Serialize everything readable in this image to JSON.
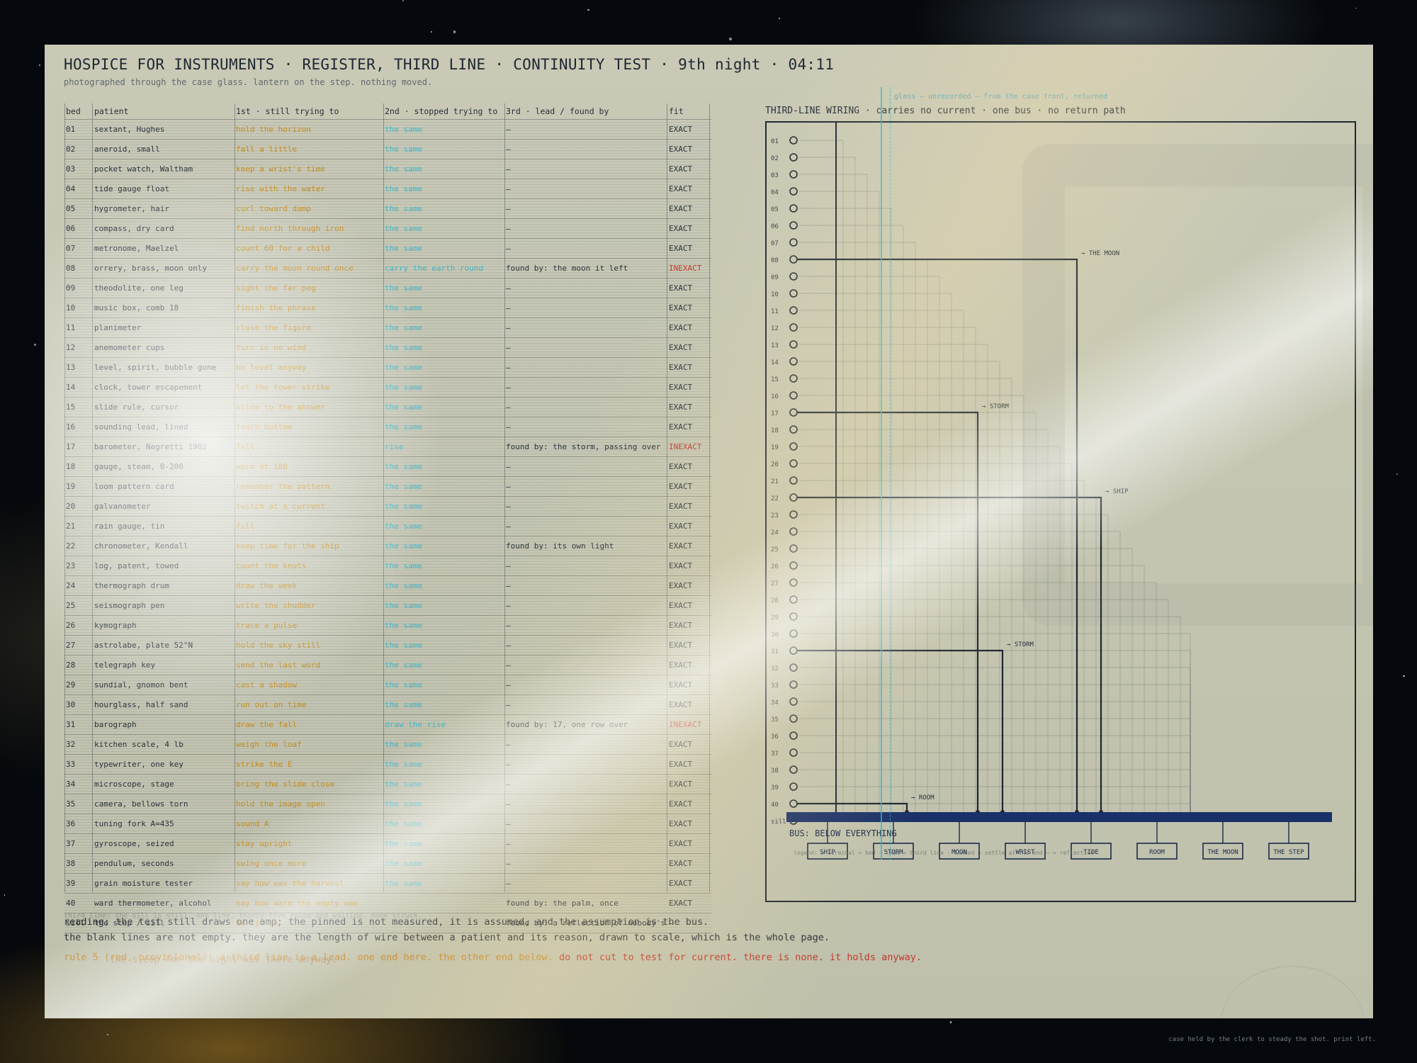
{
  "title": "HOSPICE FOR INSTRUMENTS · REGISTER, THIRD LINE · CONTINUITY TEST · 9th night · 04:11",
  "subtitle": "photographed through the case glass. lantern on the step. nothing moved.",
  "glass_label": "glass — unrecorded — from the case front, returned",
  "columns": {
    "bed": "bed",
    "patient": "patient",
    "first": "1st · still trying to",
    "second": "2nd · stopped trying to",
    "third": "3rd · lead / found by",
    "fit": "fit"
  },
  "rows": [
    {
      "bed": "01",
      "patient": "sextant, Hughes",
      "first": "hold the horizon",
      "second": "the same",
      "third": "—",
      "fit": "EXACT"
    },
    {
      "bed": "02",
      "patient": "aneroid, small",
      "first": "fall a little",
      "second": "the same",
      "third": "—",
      "fit": "EXACT"
    },
    {
      "bed": "03",
      "patient": "pocket watch, Waltham",
      "first": "keep a wrist's time",
      "second": "the same",
      "third": "—",
      "fit": "EXACT"
    },
    {
      "bed": "04",
      "patient": "tide gauge float",
      "first": "rise with the water",
      "second": "the same",
      "third": "—",
      "fit": "EXACT"
    },
    {
      "bed": "05",
      "patient": "hygrometer, hair",
      "first": "curl toward damp",
      "second": "the same",
      "third": "—",
      "fit": "EXACT"
    },
    {
      "bed": "06",
      "patient": "compass, dry card",
      "first": "find north through iron",
      "second": "the same",
      "third": "—",
      "fit": "EXACT"
    },
    {
      "bed": "07",
      "patient": "metronome, Maelzel",
      "first": "count 60 for a child",
      "second": "the same",
      "third": "—",
      "fit": "EXACT"
    },
    {
      "bed": "08",
      "patient": "orrery, brass, moon only",
      "first": "carry the moon round once",
      "second": "carry the earth round",
      "third": "found by: the moon it left",
      "fit": "INEXACT"
    },
    {
      "bed": "09",
      "patient": "theodolite, one leg",
      "first": "sight the far peg",
      "second": "the same",
      "third": "—",
      "fit": "EXACT"
    },
    {
      "bed": "10",
      "patient": "music box, comb 18",
      "first": "finish the phrase",
      "second": "the same",
      "third": "—",
      "fit": "EXACT"
    },
    {
      "bed": "11",
      "patient": "planimeter",
      "first": "close the figure",
      "second": "the same",
      "third": "—",
      "fit": "EXACT"
    },
    {
      "bed": "12",
      "patient": "anemometer cups",
      "first": "turn in no wind",
      "second": "the same",
      "third": "—",
      "fit": "EXACT"
    },
    {
      "bed": "13",
      "patient": "level, spirit, bubble gone",
      "first": "be level anyway",
      "second": "the same",
      "third": "—",
      "fit": "EXACT"
    },
    {
      "bed": "14",
      "patient": "clock, tower escapement",
      "first": "let the tower strike",
      "second": "the same",
      "third": "—",
      "fit": "EXACT"
    },
    {
      "bed": "15",
      "patient": "slide rule, cursor",
      "first": "slide to the answer",
      "second": "the same",
      "third": "—",
      "fit": "EXACT"
    },
    {
      "bed": "16",
      "patient": "sounding lead, lined",
      "first": "touch bottom",
      "second": "the same",
      "third": "—",
      "fit": "EXACT"
    },
    {
      "bed": "17",
      "patient": "barometer, Negretti 1902",
      "first": "fall",
      "second": "rise",
      "third": "found by: the storm, passing over",
      "fit": "INEXACT"
    },
    {
      "bed": "18",
      "patient": "gauge, steam, 0-200",
      "first": "warn at 180",
      "second": "the same",
      "third": "—",
      "fit": "EXACT"
    },
    {
      "bed": "19",
      "patient": "loom pattern card",
      "first": "remember the pattern",
      "second": "the same",
      "third": "—",
      "fit": "EXACT"
    },
    {
      "bed": "20",
      "patient": "galvanometer",
      "first": "twitch at a current",
      "second": "the same",
      "third": "—",
      "fit": "EXACT"
    },
    {
      "bed": "21",
      "patient": "rain gauge, tin",
      "first": "fill",
      "second": "the same",
      "third": "—",
      "fit": "EXACT"
    },
    {
      "bed": "22",
      "patient": "chronometer, Kendall",
      "first": "keep time for the ship",
      "second": "the same",
      "third": "found by: its own light",
      "fit": "EXACT"
    },
    {
      "bed": "23",
      "patient": "log, patent, towed",
      "first": "count the knots",
      "second": "the same",
      "third": "—",
      "fit": "EXACT"
    },
    {
      "bed": "24",
      "patient": "thermograph drum",
      "first": "draw the week",
      "second": "the same",
      "third": "—",
      "fit": "EXACT"
    },
    {
      "bed": "25",
      "patient": "seismograph pen",
      "first": "write the shudder",
      "second": "the same",
      "third": "—",
      "fit": "EXACT"
    },
    {
      "bed": "26",
      "patient": "kymograph",
      "first": "trace a pulse",
      "second": "the same",
      "third": "—",
      "fit": "EXACT"
    },
    {
      "bed": "27",
      "patient": "astrolabe, plate 52°N",
      "first": "hold the sky still",
      "second": "the same",
      "third": "—",
      "fit": "EXACT"
    },
    {
      "bed": "28",
      "patient": "telegraph key",
      "first": "send the last word",
      "second": "the same",
      "third": "—",
      "fit": "EXACT"
    },
    {
      "bed": "29",
      "patient": "sundial, gnomon bent",
      "first": "cast a shadow",
      "second": "the same",
      "third": "—",
      "fit": "EXACT"
    },
    {
      "bed": "30",
      "patient": "hourglass, half sand",
      "first": "run out on time",
      "second": "the same",
      "third": "—",
      "fit": "EXACT"
    },
    {
      "bed": "31",
      "patient": "barograph",
      "first": "draw the fall",
      "second": "draw the rise",
      "third": "found by: 17, one row over",
      "fit": "INEXACT"
    },
    {
      "bed": "32",
      "patient": "kitchen scale, 4 lb",
      "first": "weigh the loaf",
      "second": "the same",
      "third": "—",
      "fit": "EXACT"
    },
    {
      "bed": "33",
      "patient": "typewriter, one key",
      "first": "strike the E",
      "second": "the same",
      "third": "—",
      "fit": "EXACT"
    },
    {
      "bed": "34",
      "patient": "microscope, stage",
      "first": "bring the slide close",
      "second": "the same",
      "third": "—",
      "fit": "EXACT"
    },
    {
      "bed": "35",
      "patient": "camera, bellows torn",
      "first": "hold the image open",
      "second": "the same",
      "third": "—",
      "fit": "EXACT"
    },
    {
      "bed": "36",
      "patient": "tuning fork A=435",
      "first": "sound A",
      "second": "the same",
      "third": "—",
      "fit": "EXACT"
    },
    {
      "bed": "37",
      "patient": "gyroscope, seized",
      "first": "stay upright",
      "second": "the same",
      "third": "—",
      "fit": "EXACT"
    },
    {
      "bed": "38",
      "patient": "pendulum, seconds",
      "first": "swing once more",
      "second": "the same",
      "third": "—",
      "fit": "EXACT"
    },
    {
      "bed": "39",
      "patient": "grain moisture tester",
      "first": "say how was the harvest",
      "second": "the same",
      "third": "—",
      "fit": "EXACT"
    },
    {
      "bed": "40",
      "patient": "ward thermometer, alcohol",
      "first": "say how warm the empty was",
      "second": "",
      "third": "found by: the palm, once",
      "fit": "EXACT"
    },
    {
      "bed": "sill",
      "patient": "the step / sill",
      "first": "be lit in",
      "second": "",
      "third": "found by: a reflection of nobody's",
      "fit": "—"
    }
  ],
  "wiring": {
    "title": "THIRD-LINE WIRING · carries no current · one bus · no return path",
    "terminals": [
      "01",
      "02",
      "03",
      "04",
      "05",
      "06",
      "07",
      "08",
      "09",
      "10",
      "11",
      "12",
      "13",
      "14",
      "15",
      "16",
      "17",
      "18",
      "19",
      "20",
      "21",
      "22",
      "23",
      "24",
      "25",
      "26",
      "27",
      "28",
      "29",
      "30",
      "31",
      "32",
      "33",
      "34",
      "35",
      "36",
      "37",
      "38",
      "39",
      "40",
      "sill"
    ],
    "leads": [
      {
        "from": "08",
        "label": "→ THE MOON"
      },
      {
        "from": "17",
        "label": "→ STORM"
      },
      {
        "from": "22",
        "label": "→ SHIP"
      },
      {
        "from": "31",
        "label": "→ STORM"
      },
      {
        "from": "40",
        "label": "→ ROOM"
      }
    ],
    "bus_label": "BUS: BELOW EVERYTHING",
    "bus_taps": [
      "SHIP",
      "STORM",
      "MOON",
      "WRIST",
      "TIDE",
      "ROOM",
      "THE MOON",
      "THE STEP"
    ],
    "legend": "legend: o terminal = bed — lead = third line · landed = settle at the end — = reflection",
    "bus_color": "#1a3068"
  },
  "faint_note": "third line: the sill is still, one line, thirty-five ruled and waiting, none struck.",
  "ghost_note": "the sleep for the night was there anyway.",
  "notes": [
    "reading: the test still draws one amp; the pinned is not measured, it is assumed, and the assumption is the bus.",
    "the blank lines are not empty. they are the length of wire between a patient and its reason, drawn to scale, which is the whole page."
  ],
  "rule_note_a": "rule 5 (red, provisional): a third line is a lead. one end here. the other end below.",
  "rule_note_b": " do not cut to test for current. there is none. it holds anyway.",
  "corner_note": "case held by the clerk to steady the shot. print left."
}
